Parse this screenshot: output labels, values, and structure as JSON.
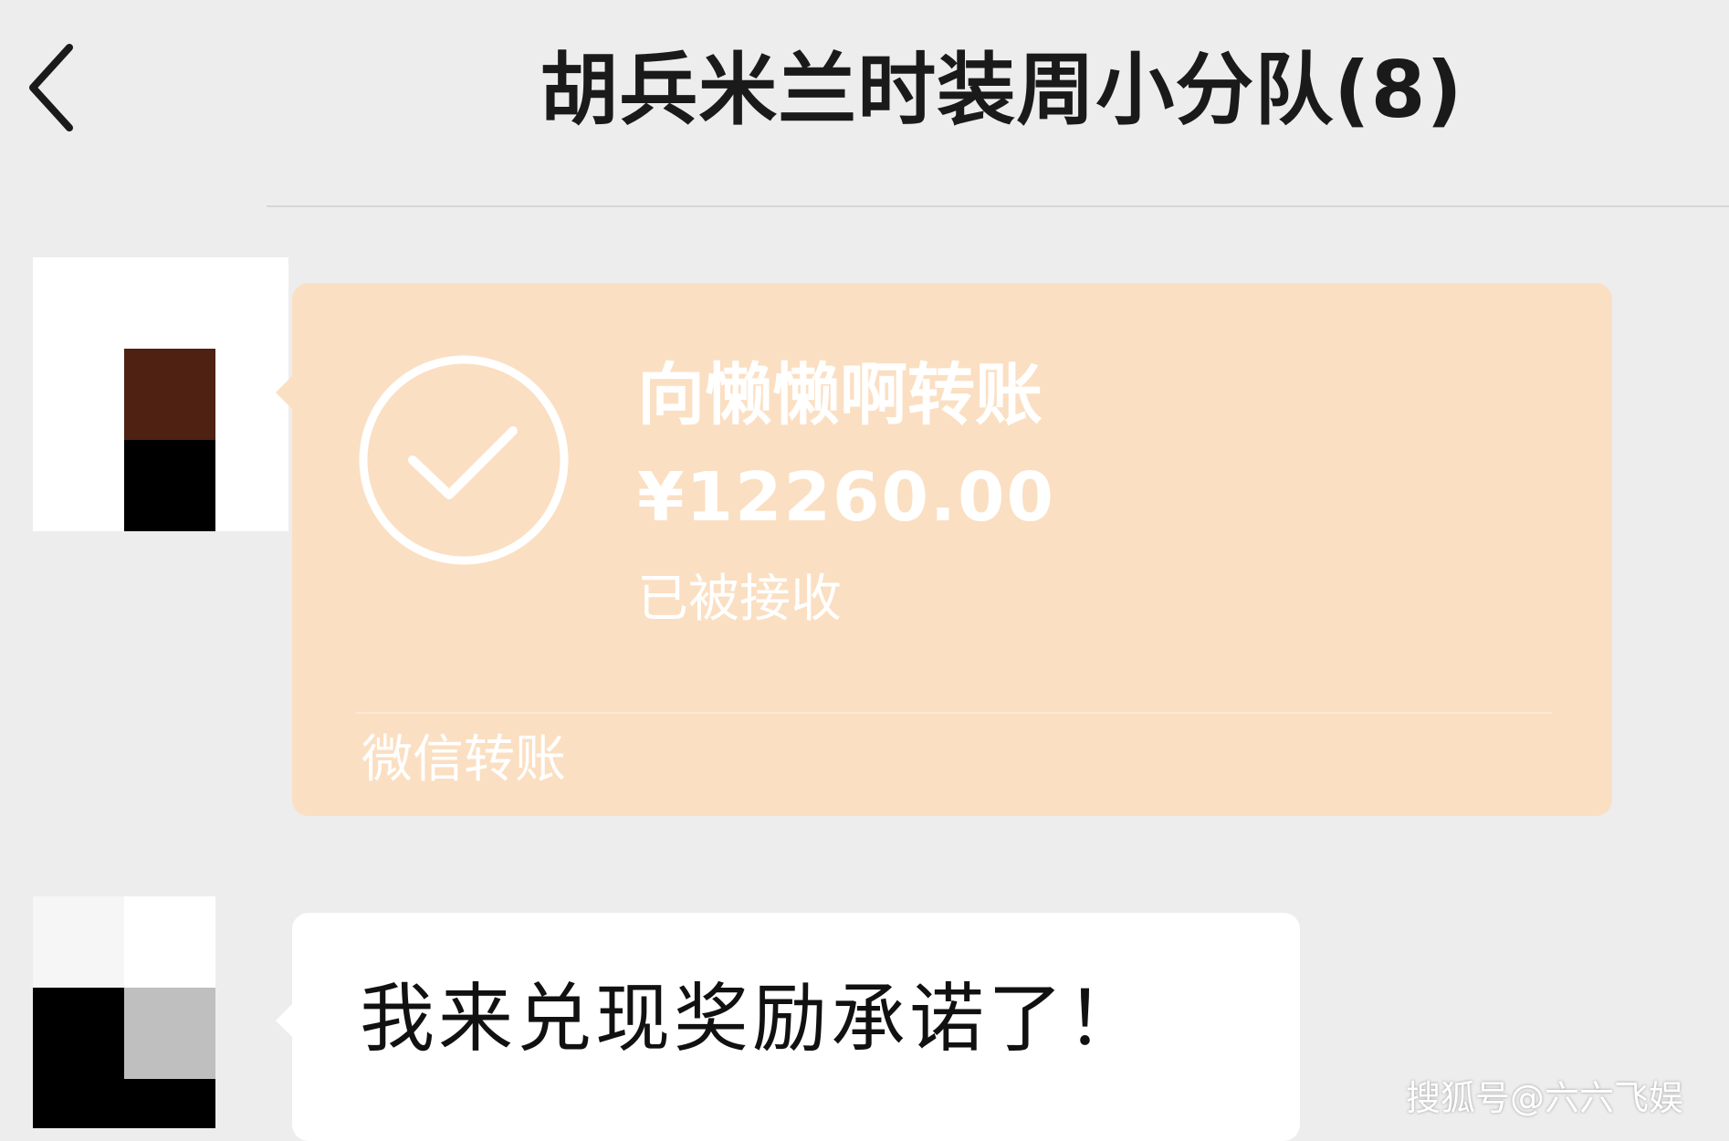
{
  "header": {
    "title": "胡兵米兰时装周小分队(8)",
    "back_icon": "chevron-left-icon"
  },
  "messages": [
    {
      "type": "transfer",
      "avatar_colors": [
        "#ffffff",
        "#4e2113",
        "#000000"
      ],
      "transfer": {
        "recipient": "向懒懒啊转账",
        "amount": "¥12260.00",
        "status": "已被接收",
        "footer": "微信转账",
        "status_icon": "check-circle-icon",
        "card_color": "#fbdfc2"
      }
    },
    {
      "type": "text",
      "avatar_colors": [
        "#f6f6f6",
        "#ffffff",
        "#000000",
        "#bfbfbf"
      ],
      "text": "我来兑现奖励承诺了！"
    }
  ],
  "watermark": "搜狐号@六六飞娱"
}
